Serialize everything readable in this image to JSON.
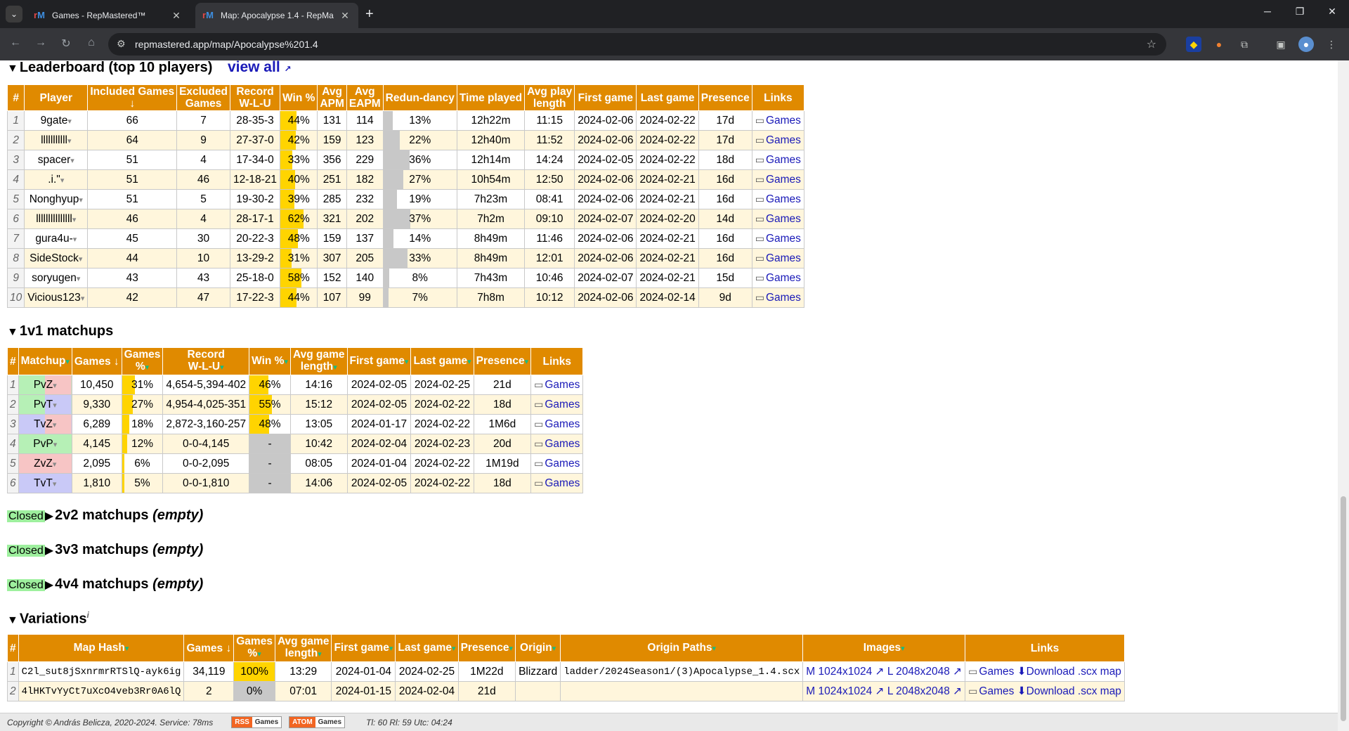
{
  "browser": {
    "tabs": [
      {
        "title": "Games - RepMastered™",
        "active": false
      },
      {
        "title": "Map: Apocalypse 1.4 - RepMa",
        "active": true
      }
    ],
    "url": "repmastered.app/map/Apocalypse%201.4"
  },
  "leaderboard": {
    "title": "Leaderboard (top 10 players)",
    "view_all": "view all",
    "headers": [
      "#",
      "Player",
      "Included Games ↓",
      "Excluded Games",
      "Record W-L-U",
      "Win %",
      "Avg APM",
      "Avg EAPM",
      "Redun-dancy",
      "Time played",
      "Avg play length",
      "First game",
      "Last game",
      "Presence",
      "Links"
    ],
    "rows": [
      {
        "n": "1",
        "player": "9gate",
        "inc": "66",
        "exc": "7",
        "rec": "28-35-3",
        "win": "44%",
        "win_f": 0.44,
        "apm": "131",
        "eapm": "114",
        "red": "13%",
        "red_f": 0.13,
        "time": "12h22m",
        "avg": "11:15",
        "first": "2024-02-06",
        "last": "2024-02-22",
        "pres": "17d",
        "link": "Games"
      },
      {
        "n": "2",
        "player": "lllllllllll",
        "inc": "64",
        "exc": "9",
        "rec": "27-37-0",
        "win": "42%",
        "win_f": 0.42,
        "apm": "159",
        "eapm": "123",
        "red": "22%",
        "red_f": 0.22,
        "time": "12h40m",
        "avg": "11:52",
        "first": "2024-02-06",
        "last": "2024-02-22",
        "pres": "17d",
        "link": "Games"
      },
      {
        "n": "3",
        "player": "spacer",
        "inc": "51",
        "exc": "4",
        "rec": "17-34-0",
        "win": "33%",
        "win_f": 0.33,
        "apm": "356",
        "eapm": "229",
        "red": "36%",
        "red_f": 0.36,
        "time": "12h14m",
        "avg": "14:24",
        "first": "2024-02-05",
        "last": "2024-02-22",
        "pres": "18d",
        "link": "Games"
      },
      {
        "n": "4",
        "player": ".i.\"",
        "inc": "51",
        "exc": "46",
        "rec": "12-18-21",
        "win": "40%",
        "win_f": 0.4,
        "apm": "251",
        "eapm": "182",
        "red": "27%",
        "red_f": 0.27,
        "time": "10h54m",
        "avg": "12:50",
        "first": "2024-02-06",
        "last": "2024-02-21",
        "pres": "16d",
        "link": "Games"
      },
      {
        "n": "5",
        "player": "Nonghyup",
        "inc": "51",
        "exc": "5",
        "rec": "19-30-2",
        "win": "39%",
        "win_f": 0.39,
        "apm": "285",
        "eapm": "232",
        "red": "19%",
        "red_f": 0.19,
        "time": "7h23m",
        "avg": "08:41",
        "first": "2024-02-06",
        "last": "2024-02-21",
        "pres": "16d",
        "link": "Games"
      },
      {
        "n": "6",
        "player": "lllllllllllllll",
        "inc": "46",
        "exc": "4",
        "rec": "28-17-1",
        "win": "62%",
        "win_f": 0.62,
        "apm": "321",
        "eapm": "202",
        "red": "37%",
        "red_f": 0.37,
        "time": "7h2m",
        "avg": "09:10",
        "first": "2024-02-07",
        "last": "2024-02-20",
        "pres": "14d",
        "link": "Games"
      },
      {
        "n": "7",
        "player": "gura4u-",
        "inc": "45",
        "exc": "30",
        "rec": "20-22-3",
        "win": "48%",
        "win_f": 0.48,
        "apm": "159",
        "eapm": "137",
        "red": "14%",
        "red_f": 0.14,
        "time": "8h49m",
        "avg": "11:46",
        "first": "2024-02-06",
        "last": "2024-02-21",
        "pres": "16d",
        "link": "Games"
      },
      {
        "n": "8",
        "player": "SideStock",
        "inc": "44",
        "exc": "10",
        "rec": "13-29-2",
        "win": "31%",
        "win_f": 0.31,
        "apm": "307",
        "eapm": "205",
        "red": "33%",
        "red_f": 0.33,
        "time": "8h49m",
        "avg": "12:01",
        "first": "2024-02-06",
        "last": "2024-02-21",
        "pres": "16d",
        "link": "Games"
      },
      {
        "n": "9",
        "player": "soryugen",
        "inc": "43",
        "exc": "43",
        "rec": "25-18-0",
        "win": "58%",
        "win_f": 0.58,
        "apm": "152",
        "eapm": "140",
        "red": "8%",
        "red_f": 0.08,
        "time": "7h43m",
        "avg": "10:46",
        "first": "2024-02-07",
        "last": "2024-02-21",
        "pres": "15d",
        "link": "Games"
      },
      {
        "n": "10",
        "player": "Vicious123",
        "inc": "42",
        "exc": "47",
        "rec": "17-22-3",
        "win": "44%",
        "win_f": 0.44,
        "apm": "107",
        "eapm": "99",
        "red": "7%",
        "red_f": 0.07,
        "time": "7h8m",
        "avg": "10:12",
        "first": "2024-02-06",
        "last": "2024-02-14",
        "pres": "9d",
        "link": "Games"
      }
    ]
  },
  "matchups": {
    "title": "1v1 matchups",
    "headers": [
      "#",
      "Matchup",
      "Games ↓",
      "Games %",
      "Record W-L-U",
      "Win %",
      "Avg game length",
      "First game",
      "Last game",
      "Presence",
      "Links"
    ],
    "rows": [
      {
        "n": "1",
        "mu": "PvZ",
        "games": "10,450",
        "gp": "31%",
        "gp_f": 0.31,
        "rec": "4,654-5,394-402",
        "win": "46%",
        "win_f": 0.46,
        "len": "14:16",
        "first": "2024-02-05",
        "last": "2024-02-25",
        "pres": "21d",
        "link": "Games"
      },
      {
        "n": "2",
        "mu": "PvT",
        "games": "9,330",
        "gp": "27%",
        "gp_f": 0.27,
        "rec": "4,954-4,025-351",
        "win": "55%",
        "win_f": 0.55,
        "len": "15:12",
        "first": "2024-02-05",
        "last": "2024-02-22",
        "pres": "18d",
        "link": "Games"
      },
      {
        "n": "3",
        "mu": "TvZ",
        "games": "6,289",
        "gp": "18%",
        "gp_f": 0.18,
        "rec": "2,872-3,160-257",
        "win": "48%",
        "win_f": 0.48,
        "len": "13:05",
        "first": "2024-01-17",
        "last": "2024-02-22",
        "pres": "1M6d",
        "link": "Games"
      },
      {
        "n": "4",
        "mu": "PvP",
        "games": "4,145",
        "gp": "12%",
        "gp_f": 0.12,
        "rec": "0-0-4,145",
        "win": "-",
        "win_f": 0,
        "len": "10:42",
        "first": "2024-02-04",
        "last": "2024-02-23",
        "pres": "20d",
        "link": "Games"
      },
      {
        "n": "5",
        "mu": "ZvZ",
        "games": "2,095",
        "gp": "6%",
        "gp_f": 0.06,
        "rec": "0-0-2,095",
        "win": "-",
        "win_f": 0,
        "len": "08:05",
        "first": "2024-01-04",
        "last": "2024-02-22",
        "pres": "1M19d",
        "link": "Games"
      },
      {
        "n": "6",
        "mu": "TvT",
        "games": "1,810",
        "gp": "5%",
        "gp_f": 0.05,
        "rec": "0-0-1,810",
        "win": "-",
        "win_f": 0,
        "len": "14:06",
        "first": "2024-02-05",
        "last": "2024-02-22",
        "pres": "18d",
        "link": "Games"
      }
    ]
  },
  "closed_sections": [
    {
      "label": "Closed",
      "title": "2v2 matchups",
      "note": "(empty)"
    },
    {
      "label": "Closed",
      "title": "3v3 matchups",
      "note": "(empty)"
    },
    {
      "label": "Closed",
      "title": "4v4 matchups",
      "note": "(empty)"
    }
  ],
  "variations": {
    "title": "Variations",
    "info": "i",
    "headers": [
      "#",
      "Map Hash",
      "Games ↓",
      "Games %",
      "Avg game length",
      "First game",
      "Last game",
      "Presence",
      "Origin",
      "Origin Paths",
      "Images",
      "Links"
    ],
    "rows": [
      {
        "n": "1",
        "hash": "C2l_sut8jSxnrmrRTSlQ-ayk6ig",
        "games": "34,119",
        "gp": "100%",
        "gp_f": 1.0,
        "len": "13:29",
        "first": "2024-01-04",
        "last": "2024-02-25",
        "pres": "1M22d",
        "origin": "Blizzard",
        "path": "ladder/2024Season1/(3)Apocalypse_1.4.scx",
        "img_m": "M 1024x1024",
        "img_l": "L 2048x2048",
        "link": "Games",
        "dl": "Download .scx map"
      },
      {
        "n": "2",
        "hash": "4lHKTvYyCt7uXcO4veb3Rr0A6lQ",
        "games": "2",
        "gp": "0%",
        "gp_f": 0.0,
        "len": "07:01",
        "first": "2024-01-15",
        "last": "2024-02-04",
        "pres": "21d",
        "origin": "",
        "path": "",
        "img_m": "M 1024x1024",
        "img_l": "L 2048x2048",
        "link": "Games",
        "dl": "Download .scx map"
      }
    ]
  },
  "footer": {
    "copyright": "Copyright © András Belicza, 2020-2024. Service: 78ms",
    "rss": "RSS",
    "atom": "ATOM",
    "games": "Games",
    "stats": "Tl: 60 Rl: 59 Utc: 04:24"
  },
  "colors": {
    "header": "#e08a00",
    "bar": "#ffd400",
    "link": "#1a1ab8"
  }
}
